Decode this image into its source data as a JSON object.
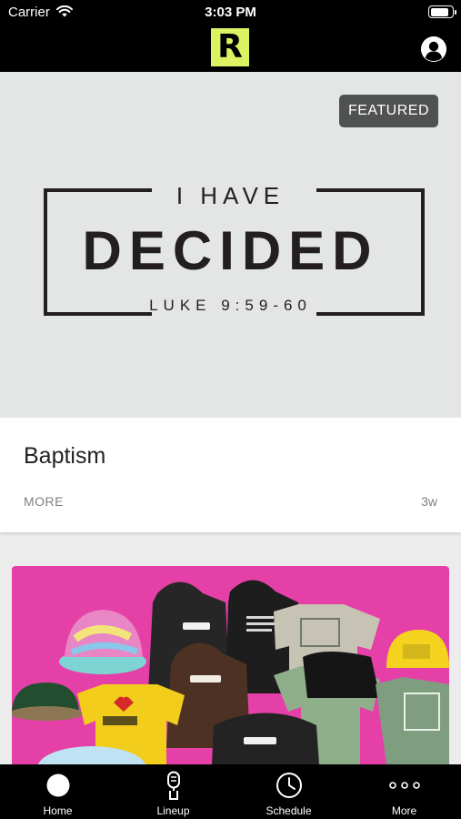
{
  "status_bar": {
    "carrier": "Carrier",
    "time": "3:03 PM"
  },
  "header": {
    "logo_letter": "R",
    "profile_icon": "user-circle-icon"
  },
  "featured": {
    "badge": "FEATURED",
    "artwork": {
      "line1": "I HAVE",
      "line2": "DECIDED",
      "line3": "LUKE 9:59-60"
    },
    "title": "Baptism",
    "more_label": "MORE",
    "age": "3w"
  },
  "merch_card": {
    "image": "merch-photo"
  },
  "tabs": [
    {
      "label": "Home",
      "icon": "home-icon"
    },
    {
      "label": "Lineup",
      "icon": "microphone-icon"
    },
    {
      "label": "Schedule",
      "icon": "clock-icon"
    },
    {
      "label": "More",
      "icon": "more-dots-icon"
    }
  ],
  "colors": {
    "accent": "#dcf262",
    "badge": "#505151",
    "merch_bg": "#e540a8"
  }
}
